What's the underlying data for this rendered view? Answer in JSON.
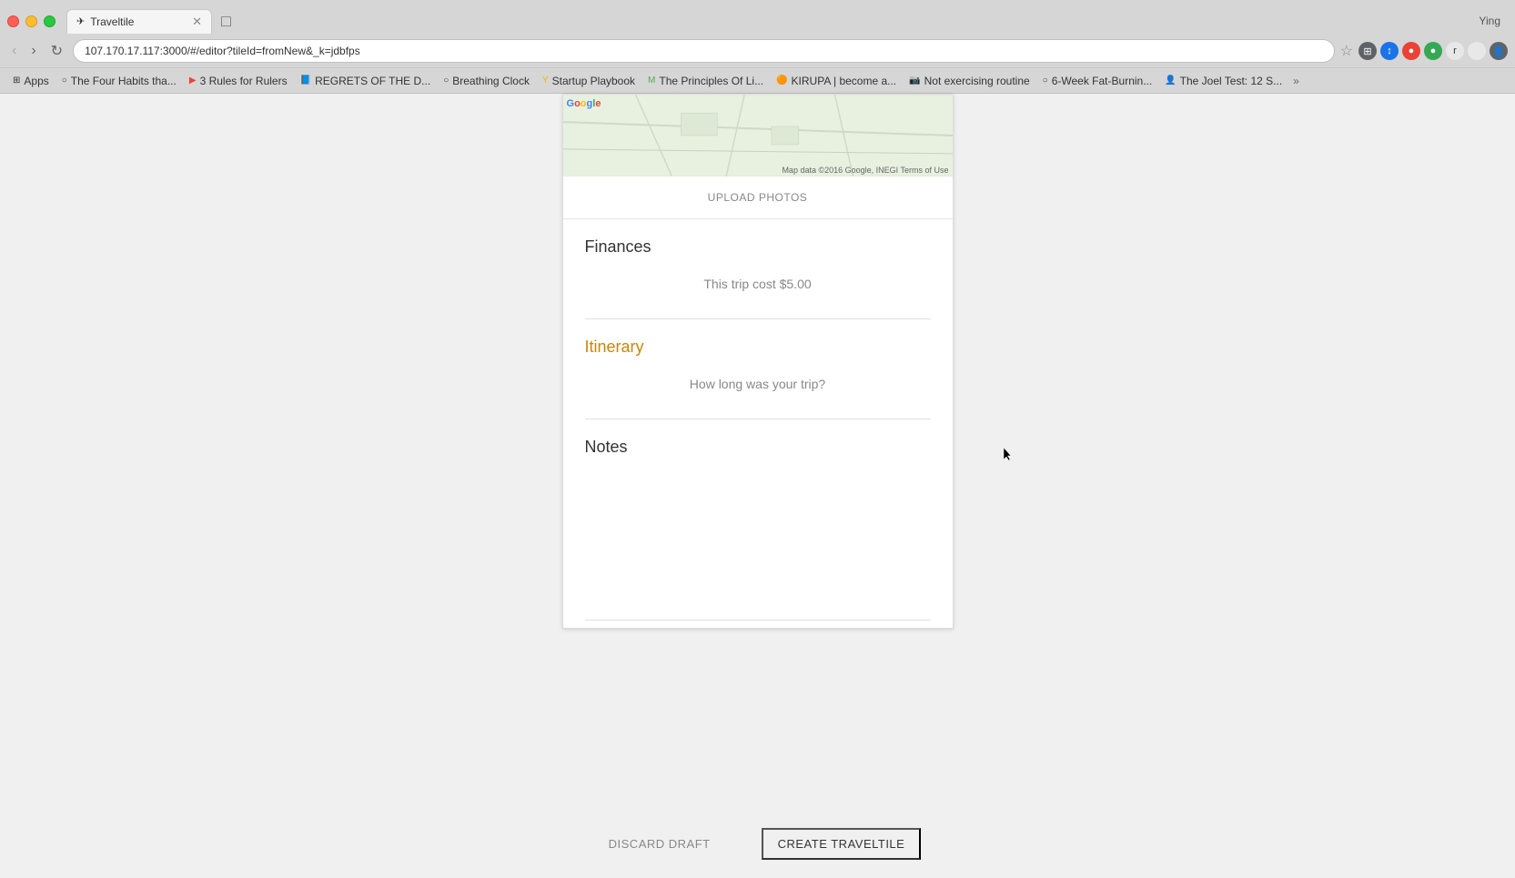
{
  "browser": {
    "tab_title": "Traveltile",
    "tab_icon": "✈",
    "url": "107.170.17.117:3000/#/editor?tileId=fromNew&_k=jdbfps",
    "new_tab_label": "+",
    "user_initial": "Ying"
  },
  "bookmarks": [
    {
      "id": "apps",
      "label": "Apps",
      "favicon": "⊞"
    },
    {
      "id": "four-habits",
      "label": "The Four Habits tha...",
      "favicon": "○"
    },
    {
      "id": "3-rules",
      "label": "3 Rules for Rulers",
      "favicon": "▶"
    },
    {
      "id": "regrets",
      "label": "REGRETS OF THE D...",
      "favicon": "📘"
    },
    {
      "id": "breathing-clock",
      "label": "Breathing Clock",
      "favicon": "○"
    },
    {
      "id": "startup-playbook",
      "label": "Startup Playbook",
      "favicon": "Y"
    },
    {
      "id": "principles",
      "label": "The Principles Of Li...",
      "favicon": "M"
    },
    {
      "id": "kirupa",
      "label": "KIRUPA | become a...",
      "favicon": "🟠"
    },
    {
      "id": "not-exercising",
      "label": "Not exercising routine",
      "favicon": "📷"
    },
    {
      "id": "6-week",
      "label": "6-Week Fat-Burnin...",
      "favicon": "○"
    },
    {
      "id": "joel-test",
      "label": "The Joel Test: 12 S...",
      "favicon": "👤"
    }
  ],
  "map": {
    "google_logo": [
      "G",
      "o",
      "o",
      "g",
      "l",
      "e"
    ],
    "credit": "Map data ©2016 Google, INEGI   Terms of Use"
  },
  "card": {
    "upload_photos_label": "UPLOAD PHOTOS",
    "finances": {
      "title": "Finances",
      "content": "This trip cost $5.00"
    },
    "itinerary": {
      "title": "Itinerary",
      "content": "How long was your trip?"
    },
    "notes": {
      "title": "Notes"
    }
  },
  "footer": {
    "discard_label": "DISCARD DRAFT",
    "create_label": "CREATE TRAVELTILE"
  }
}
